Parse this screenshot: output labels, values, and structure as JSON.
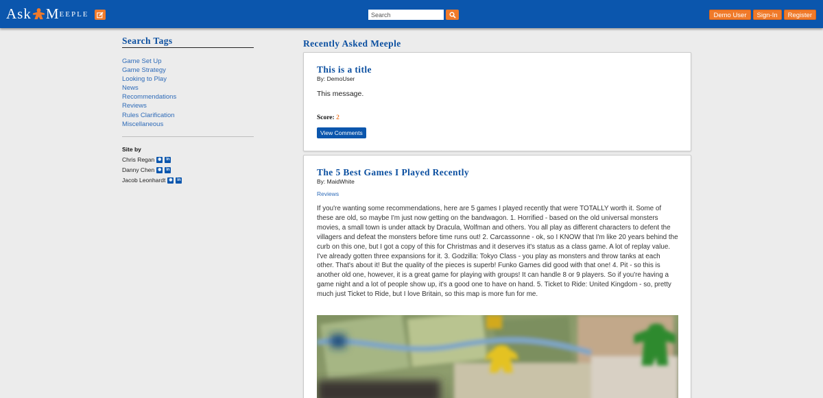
{
  "header": {
    "logo_ask": "Ask",
    "logo_meeple": "Meeple",
    "search_placeholder": "Search",
    "nav": [
      "Demo User",
      "Sign-In",
      "Register"
    ]
  },
  "sidebar": {
    "title": "Search Tags",
    "tags": [
      "Game Set Up",
      "Game Strategy",
      "Looking to Play",
      "News",
      "Recommendations",
      "Reviews",
      "Rules Clarification",
      "Miscellaneous"
    ],
    "site_by_label": "Site by",
    "authors": [
      "Chris Regan",
      "Danny Chen",
      "Jacob Leonhardt"
    ]
  },
  "main": {
    "title": "Recently Asked Meeple",
    "posts": [
      {
        "title": "This is a title",
        "by": "By: DemoUser",
        "message": "This message.",
        "score_label": "Score:",
        "score": "2",
        "button": "View Comments"
      },
      {
        "title": "The 5 Best Games I Played Recently",
        "by": "By: MaidWhite",
        "tag": "Reviews",
        "body": "If you're wanting some recommendations, here are 5 games I played recently that were TOTALLY worth it. Some of these are old, so maybe I'm just now getting on the bandwagon. 1. Horrified - based on the old universal monsters movies, a small town is under attack by Dracula, Wolfman and others. You all play as different characters to defent the villagers and defeat the monsters before time runs out! 2. Carcassonne - ok, so I KNOW that I'm like 20 years behind the curb on this one, but I got a copy of this for Christmas and it deserves it's status as a class game. A lot of replay value. I've already gotten three expansions for it. 3. Godzilla: Tokyo Class - you play as monsters and throw tanks at each other. That's about it! But the quality of the pieces is superb! Funko Games did good with that one! 4. Pit - so this is another old one, however, it is a great game for playing with groups! It can handle 8 or 9 players. So if you're having a game night and a lot of people show up, it's a good one to have on hand. 5. Ticket to Ride: United Kingdom - so, pretty much just Ticket to Ride, but I love Britain, so this map is more fun for me."
      }
    ]
  },
  "colors": {
    "navbar": "#0b56ad",
    "accent_orange": "#f07a2a",
    "heading_blue": "#0b4fa0",
    "link_blue": "#2e6bb8"
  }
}
